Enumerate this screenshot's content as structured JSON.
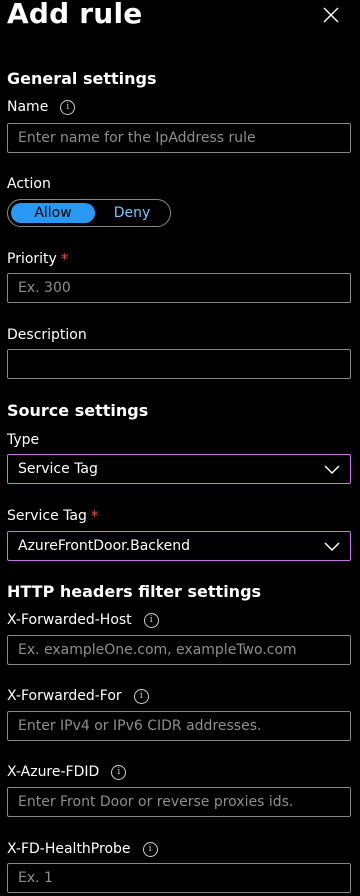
{
  "panel": {
    "title": "Add rule",
    "close_icon": "close-icon"
  },
  "general": {
    "heading": "General settings",
    "name": {
      "label": "Name",
      "placeholder": "Enter name for the IpAddress rule",
      "value": ""
    },
    "action": {
      "label": "Action",
      "options": [
        "Allow",
        "Deny"
      ],
      "selected": "Allow"
    },
    "priority": {
      "label": "Priority",
      "required": "*",
      "placeholder": "Ex. 300",
      "value": ""
    },
    "description": {
      "label": "Description",
      "value": ""
    }
  },
  "source": {
    "heading": "Source settings",
    "type": {
      "label": "Type",
      "value": "Service Tag"
    },
    "service_tag": {
      "label": "Service Tag",
      "required": "*",
      "value": "AzureFrontDoor.Backend"
    }
  },
  "http_headers": {
    "heading": "HTTP headers filter settings",
    "forwarded_host": {
      "label": "X-Forwarded-Host",
      "placeholder": "Ex. exampleOne.com, exampleTwo.com",
      "value": ""
    },
    "forwarded_for": {
      "label": "X-Forwarded-For",
      "placeholder": "Enter IPv4 or IPv6 CIDR addresses.",
      "value": ""
    },
    "azure_fdid": {
      "label": "X-Azure-FDID",
      "placeholder": "Enter Front Door or reverse proxies ids.",
      "value": ""
    },
    "fd_health_probe": {
      "label": "X-FD-HealthProbe",
      "placeholder": "Ex. 1",
      "value": ""
    }
  },
  "colors": {
    "background": "#000000",
    "text": "#ffffff",
    "input_border": "#8a8886",
    "select_border": "#c774e0",
    "toggle_selected": "#2899f5",
    "toggle_unselected_text": "#7cc4ff",
    "required": "#e74856",
    "placeholder": "#8e8e8e"
  },
  "icons": {
    "info": "info-icon",
    "chevron": "chevron-down-icon"
  }
}
